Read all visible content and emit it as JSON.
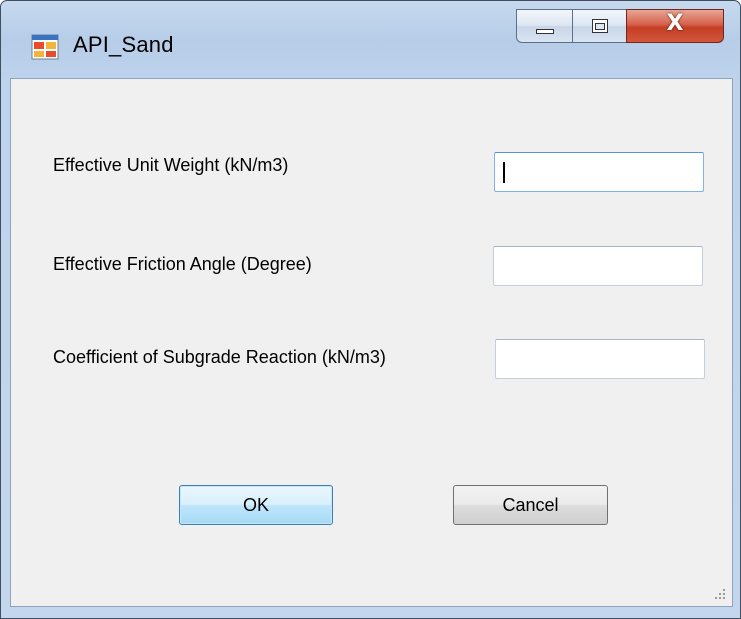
{
  "window": {
    "title": "API_Sand",
    "icon": "app-window-icon",
    "controls": {
      "minimize": "minimize-icon",
      "maximize": "maximize-icon",
      "close_glyph": "X"
    }
  },
  "form": {
    "fields": [
      {
        "label": "Effective Unit Weight (kN/m3)",
        "value": "",
        "focused": true
      },
      {
        "label": "Effective Friction Angle (Degree)",
        "value": "",
        "focused": false
      },
      {
        "label": "Coefficient of Subgrade Reaction (kN/m3)",
        "value": "",
        "focused": false
      }
    ],
    "ok_label": "OK",
    "cancel_label": "Cancel"
  },
  "colors": {
    "title_bar": "#b7cde8",
    "client_background": "#f0f0f0",
    "close_button": "#c43e25",
    "default_button_border": "#3c7fb1"
  }
}
